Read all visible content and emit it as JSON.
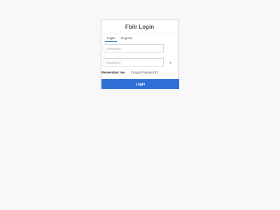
{
  "login": {
    "title": "Fbilr Login",
    "tabs": [
      {
        "label": "Login"
      },
      {
        "label": "Register"
      }
    ],
    "username_placeholder": "Username",
    "password_placeholder": "Password",
    "remember_me": "Remember me",
    "forgot_password": "Forgot Password?",
    "submit_label": "Login"
  },
  "colors": {
    "primary": "#2f6fd6",
    "background": "#f8f8f8",
    "card": "#ffffff"
  }
}
